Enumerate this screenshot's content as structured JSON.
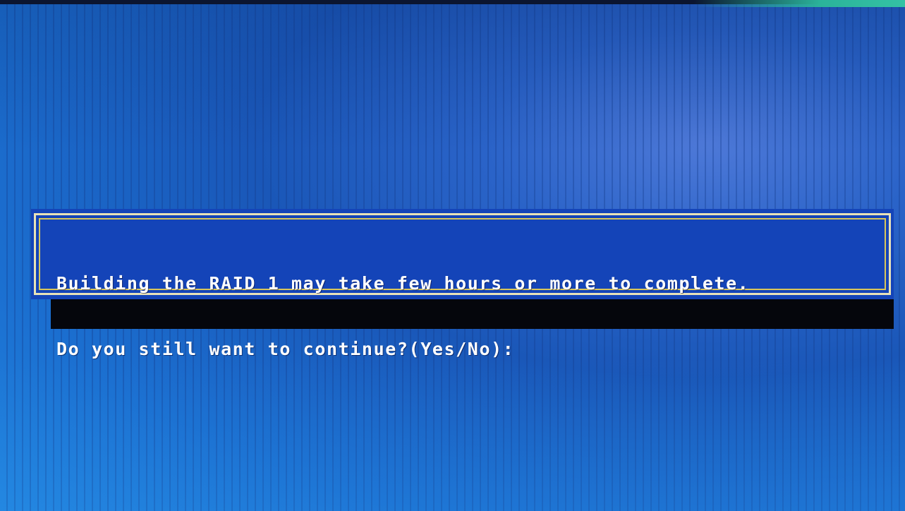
{
  "dialog": {
    "line1": "Building the RAID 1 may take few hours or more to complete.",
    "line2": "Do you still want to continue?(Yes/No):"
  },
  "colors": {
    "background": "#1e63c6",
    "dialog_bg": "#1444b8",
    "frame_outer": "#e8e2b8",
    "frame_inner": "#d9c65a",
    "text": "#ffffff",
    "shadow": "#05060c"
  }
}
